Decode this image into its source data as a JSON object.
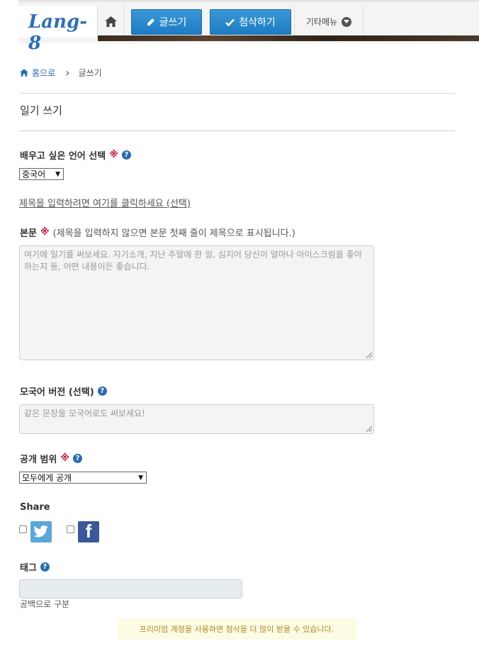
{
  "header": {
    "logo": "Lang-8",
    "write_label": "글쓰기",
    "correct_label": "첨삭하기",
    "other_menu_label": "기타메뉴"
  },
  "breadcrumb": {
    "home": "홈으로",
    "separator": "›",
    "current": "글쓰기"
  },
  "page": {
    "title": "일기 쓰기"
  },
  "form": {
    "language": {
      "label": "배우고 싶은 언어 선택",
      "required_mark": "※",
      "selected": "중국어"
    },
    "title_link": "제목을 입력하려면 여기를 클릭하세요 (선택)",
    "body": {
      "label": "본문",
      "required_mark": "※",
      "note": "(제목을 입력하지 않으면 본문 첫째 줄이 제목으로 표시됩니다.)",
      "placeholder": "여기에 일기를 써보세요. 자기소개, 지난 주말에 한 일, 심지어 당신이 얼마나 아이스크림을 좋아하는지 등, 어떤 내용이든 좋습니다."
    },
    "native": {
      "label": "모국어 버전 (선택)",
      "placeholder": "같은 문장을 모국어로도 써보세요!"
    },
    "visibility": {
      "label": "공개 범위",
      "required_mark": "※",
      "selected": "모두에게 공개"
    },
    "share": {
      "label": "Share"
    },
    "tags": {
      "label": "태그",
      "hint": "공백으로 구분"
    }
  },
  "premium_notice": "프리미엄 계정을 사용하면 첨삭을 더 많이 받을 수 있습니다.",
  "icons": {
    "home": "home-icon",
    "pencil": "pencil-icon",
    "check": "check-icon",
    "dropdown": "chevron-down-icon",
    "help": "help-icon",
    "twitter": "twitter-icon",
    "facebook": "facebook-icon"
  },
  "colors": {
    "brand_blue": "#2f6fb7",
    "button_blue": "#1d7cc2",
    "required_red": "#c0143c",
    "premium_bg": "#fdfbe3",
    "premium_text": "#b08a2c"
  }
}
